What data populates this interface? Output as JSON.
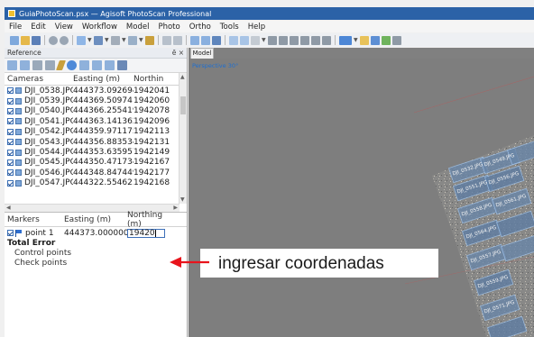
{
  "window": {
    "title": "GuiaPhotoScan.psx — Agisoft PhotoScan Professional"
  },
  "menu": [
    "File",
    "Edit",
    "View",
    "Workflow",
    "Model",
    "Photo",
    "Ortho",
    "Tools",
    "Help"
  ],
  "reference_panel": {
    "title": "Reference",
    "controls": "ē ×",
    "cameras_table": {
      "headers": [
        "Cameras",
        "Easting (m)",
        "Northin"
      ],
      "rows": [
        {
          "name": "DJI_0538.JPG",
          "easting": "444373.092694",
          "northing": "1942041"
        },
        {
          "name": "DJI_0539.JPG",
          "easting": "444369.509741",
          "northing": "1942060"
        },
        {
          "name": "DJI_0540.JPG",
          "easting": "444366.255419",
          "northing": "1942078"
        },
        {
          "name": "DJI_0541.JPG",
          "easting": "444363.141362",
          "northing": "1942096"
        },
        {
          "name": "DJI_0542.JPG",
          "easting": "444359.971175",
          "northing": "1942113"
        },
        {
          "name": "DJI_0543.JPG",
          "easting": "444356.883534",
          "northing": "1942131"
        },
        {
          "name": "DJI_0544.JPG",
          "easting": "444353.635957",
          "northing": "1942149"
        },
        {
          "name": "DJI_0545.JPG",
          "easting": "444350.471734",
          "northing": "1942167"
        },
        {
          "name": "DJI_0546.JPG",
          "easting": "444348.847449",
          "northing": "1942177"
        },
        {
          "name": "DJI_0547.JPG",
          "easting": "444322.554623",
          "northing": "1942168"
        }
      ]
    },
    "markers_table": {
      "headers": [
        "Markers",
        "Easting (m)",
        "Northing (m)"
      ],
      "marker": {
        "name": "point 1",
        "easting": "444373.000000",
        "northing_input": "19420"
      },
      "total_error": "Total Error",
      "control_points": "Control points",
      "check_points": "Check points"
    }
  },
  "model_view": {
    "tab": "Model",
    "view_label": "Perspective 30°"
  },
  "annotation": {
    "text": "ingresar coordenadas",
    "arrow_color": "#e8141c"
  },
  "model_photo_labels": [
    "DJI_0532.JPG",
    "DJI_0549.JPG",
    "DJI_0551.JPG",
    "DJI_0556.JPG",
    "DJI_0558.JPG",
    "DJI_0561.JPG",
    "DJI_0564.JPG",
    "DJI_0557.JPG",
    "DJI_0559.JPG",
    "DJI_0571.JPG"
  ],
  "colors": {
    "titlebar": "#2b62a7",
    "viewport_bg": "#7e7e7e",
    "selection_accent": "#3d6fb8"
  }
}
